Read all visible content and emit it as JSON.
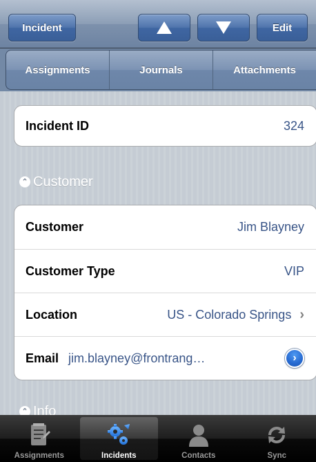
{
  "navbar": {
    "back_label": "Incident",
    "edit_label": "Edit"
  },
  "segments": [
    "Assignments",
    "Journals",
    "Attachments"
  ],
  "incident": {
    "id_label": "Incident ID",
    "id_value": "324"
  },
  "sections": {
    "customer_title": "Customer",
    "info_title": "Info"
  },
  "customer_rows": [
    {
      "label": "Customer",
      "value": "Jim Blayney"
    },
    {
      "label": "Customer Type",
      "value": "VIP"
    },
    {
      "label": "Location",
      "value": "US - Colorado Springs"
    },
    {
      "label": "Email",
      "value": "jim.blayney@frontrang…"
    }
  ],
  "tabs": [
    {
      "label": "Assignments",
      "icon": "assignments-icon"
    },
    {
      "label": "Incidents",
      "icon": "gears-icon"
    },
    {
      "label": "Contacts",
      "icon": "person-icon"
    },
    {
      "label": "Sync",
      "icon": "sync-icon"
    }
  ],
  "colors": {
    "value_text": "#385487",
    "accent_blue": "#3a5f98"
  }
}
